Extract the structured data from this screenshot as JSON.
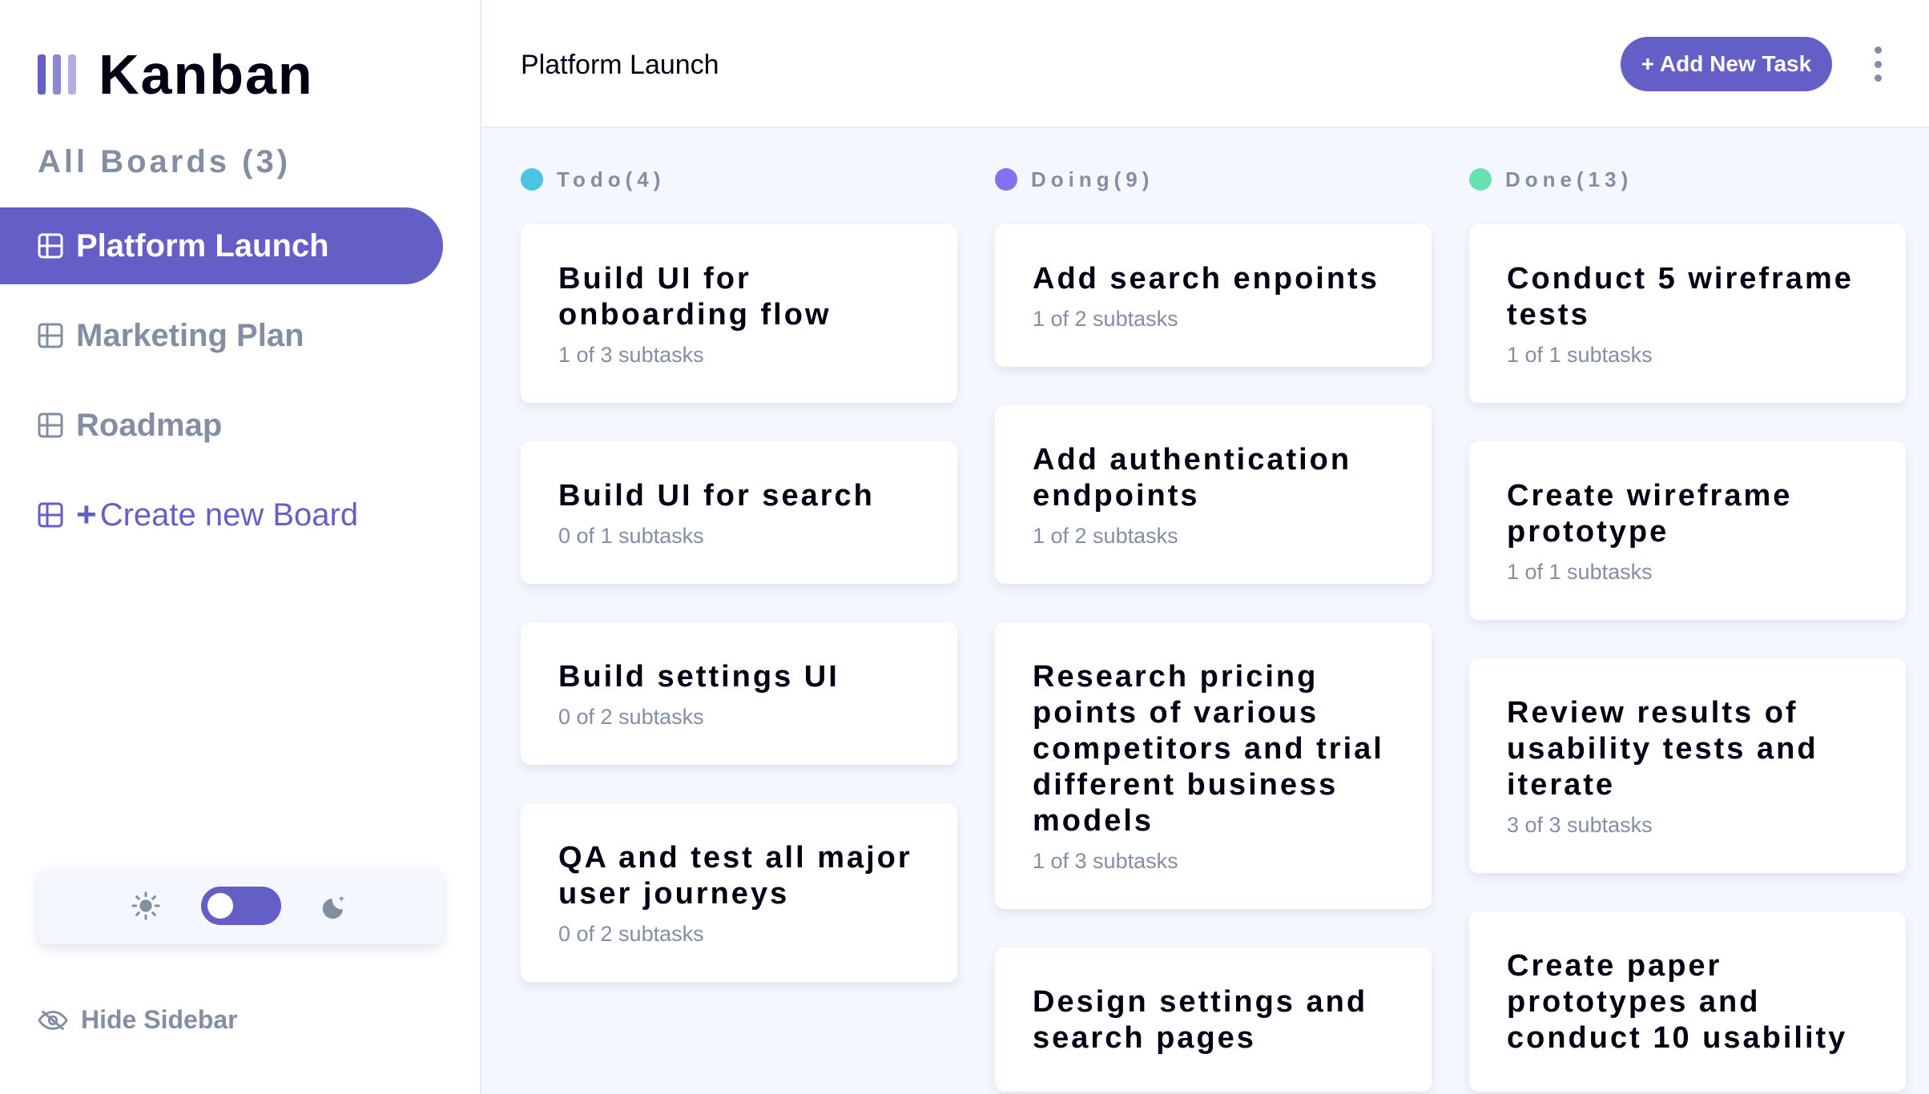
{
  "app": {
    "name": "Kanban",
    "accent": "#635fc7"
  },
  "sidebar": {
    "all_boards_label": "All Boards (3)",
    "boards": [
      {
        "label": "Platform Launch",
        "active": true
      },
      {
        "label": "Marketing Plan",
        "active": false
      },
      {
        "label": "Roadmap",
        "active": false
      }
    ],
    "create_label": "Create new Board",
    "hide_label": "Hide Sidebar"
  },
  "header": {
    "board_title": "Platform Launch",
    "add_task_label": "+ Add New Task"
  },
  "columns": [
    {
      "title": "Todo(4)",
      "color": "#49c4e5",
      "cards": [
        {
          "title": "Build UI for onboarding flow",
          "subtasks": "1 of 3 subtasks"
        },
        {
          "title": "Build UI for search",
          "subtasks": "0 of 1 subtasks"
        },
        {
          "title": "Build settings UI",
          "subtasks": "0 of 2 subtasks"
        },
        {
          "title": "QA and test all major user journeys",
          "subtasks": "0 of 2 subtasks"
        }
      ]
    },
    {
      "title": "Doing(9)",
      "color": "#8471f2",
      "cards": [
        {
          "title": "Add search enpoints",
          "subtasks": "1 of 2 subtasks"
        },
        {
          "title": "Add authentication endpoints",
          "subtasks": "1 of 2 subtasks"
        },
        {
          "title": "Research pricing points of various competitors and trial different business models",
          "subtasks": "1 of 3 subtasks"
        },
        {
          "title": "Design settings and search pages",
          "subtasks": ""
        }
      ]
    },
    {
      "title": "Done(13)",
      "color": "#67e2ae",
      "cards": [
        {
          "title": "Conduct 5 wireframe tests",
          "subtasks": "1 of 1 subtasks"
        },
        {
          "title": "Create wireframe prototype",
          "subtasks": "1 of 1 subtasks"
        },
        {
          "title": "Review results of usability tests and iterate",
          "subtasks": "3 of 3 subtasks"
        },
        {
          "title": "Create paper prototypes and conduct 10 usability",
          "subtasks": ""
        }
      ]
    }
  ]
}
